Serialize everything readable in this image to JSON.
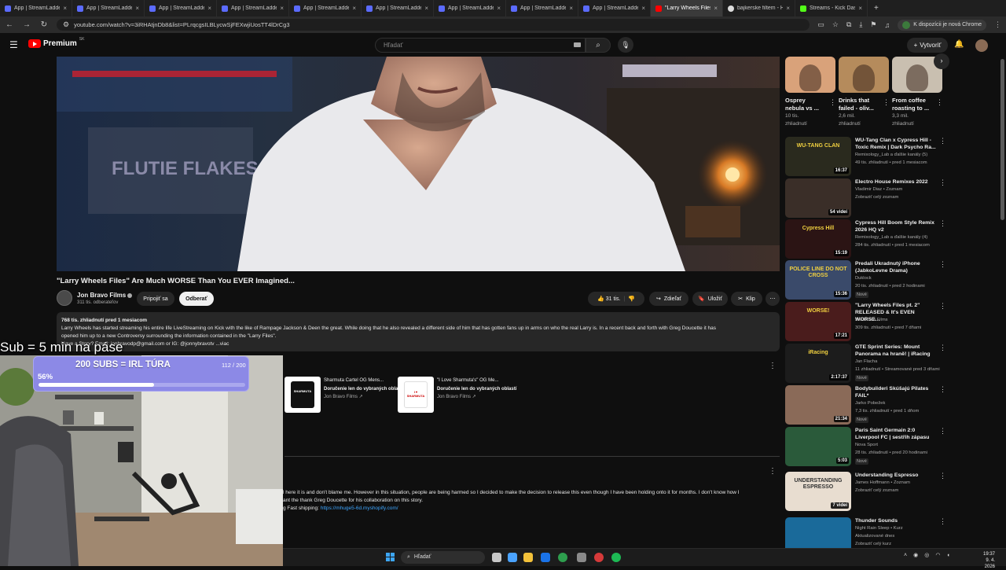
{
  "tabs": [
    {
      "title": "App | StreamLadder",
      "icon": "streamladder-icon",
      "active": false
    },
    {
      "title": "App | StreamLadder",
      "icon": "streamladder-icon",
      "active": false
    },
    {
      "title": "App | StreamLadder",
      "icon": "streamladder-icon",
      "active": false
    },
    {
      "title": "App | StreamLadder",
      "icon": "streamladder-icon",
      "active": false
    },
    {
      "title": "App | StreamLadder",
      "icon": "streamladder-icon",
      "active": false
    },
    {
      "title": "App | StreamLadder",
      "icon": "streamladder-icon",
      "active": false
    },
    {
      "title": "App | StreamLadder",
      "icon": "streamladder-icon",
      "active": false
    },
    {
      "title": "App | StreamLadder",
      "icon": "streamladder-icon",
      "active": false
    },
    {
      "title": "App | StreamLadder",
      "icon": "streamladder-icon",
      "active": false
    },
    {
      "title": "\"Larry Wheels Files\" Ar",
      "icon": "youtube-icon",
      "active": true
    },
    {
      "title": "bajkerske filtem - Hľad",
      "icon": "google-icon",
      "active": false
    },
    {
      "title": "Streams - Kick Dashbo",
      "icon": "kick-icon",
      "active": false
    }
  ],
  "browser": {
    "url": "youtube.com/watch?v=3iRHAtjnDb8&list=PLrqcgsILBLycwSjFEXwjiUosTT4lDrCg3",
    "profile_label": "K dispozícii je nová Chrome",
    "new_tab": "+"
  },
  "youtube": {
    "logo_text": "Premium",
    "logo_country": "SK",
    "search_placeholder": "Hľadať",
    "create_label": "Vytvoriť"
  },
  "video": {
    "title": "\"Larry Wheels Files\" Are Much WORSE Than You EVER Imagined...",
    "channel": "Jon Bravo Films",
    "subscribers": "311 tis. odberateľov",
    "join_label": "Pripojiť sa",
    "subscribe_label": "Odberať",
    "likes": "31 tis.",
    "share_label": "Zdieľať",
    "save_label": "Uložiť",
    "clip_label": "Klip",
    "description": {
      "stats": "768 tis. zhliadnutí  pred 1 mesiacom",
      "line1": "Larry Wheels has started streaming his entire life LiveStreaming on Kick with the like of Rampage Jackson & Deen the great. While doing that he also revealed a different side of him that has gotten fans up in arms on who the real Larry is. In a recent back and forth with Greg Doucette it has",
      "line2": "opened him up to a new Controversy surrounding the information contained in the \"Larry Files\".",
      "line3": "Have a Story? Email: jonbravodp@gmail.com or IG: @jonnybravotv",
      "more": "...viac"
    },
    "banner_wall": "FLUTIE FLAKES"
  },
  "merch": [
    {
      "title": "Sharmuta Cartel OG Mens...",
      "shipping": "Doručenie len do vybraných oblastí",
      "channel": "Jon Bravo Films",
      "shirt_color": "#111111"
    },
    {
      "title": "\"I Love Sharmuta's\" OG Me...",
      "shipping": "Doručenie len do vybraných oblastí",
      "channel": "Jon Bravo Films",
      "shirt_color": "#ffffff"
    }
  ],
  "merch_shirt_texts": [
    "SHARMUTA",
    "I ♥ SHARMUTA"
  ],
  "pinned_comment": {
    "line1": "l here it is and don't blame me. However in this situation, people are being harmed so I decided to make the decision to release this even though I have been holding onto it for months. I don't know how I",
    "line2": "ant the thank Greg Doucette for his collaboration on this story.",
    "line3_prefix": "g Fast shipping: ",
    "link": "https://mhuge5-6d.myshopify.com/"
  },
  "shorts": [
    {
      "title_l1": "Osprey",
      "title_l2": "nebula vs ...",
      "views_l1": "10 tis.",
      "views_l2": "zhliadnutí",
      "color": "#d9a27a"
    },
    {
      "title_l1": "Drinks that",
      "title_l2": "failed - oliv...",
      "views_l1": "2,6 mil.",
      "views_l2": "zhliadnutí",
      "color": "#b58b5c"
    },
    {
      "title_l1": "From coffee",
      "title_l2": "roasting to ...",
      "views_l1": "3,3 mil.",
      "views_l2": "zhliadnutí",
      "color": "#c9bfb0"
    }
  ],
  "recommendations": [
    {
      "title_l1": "WU-Tang Clan x Cypress Hill -",
      "title_l2": "Toxic Remix | Dark Psycho Ra...",
      "channel": "Remixology_Lab a ďalšie kanály (5)",
      "meta": "49 tis. zhliadnutí • pred 1 mesiacom",
      "badge": "16:37",
      "new": "",
      "thumb": "#2a2a1e",
      "thumb_text": "WU-TANG CLAN"
    },
    {
      "title_l1": "Electro House Remixes 2022",
      "title_l2": "",
      "channel": "Vladimir Diaz • Zoznam",
      "meta": "Zobraziť celý zoznam",
      "badge": "54 videí",
      "new": "",
      "thumb": "#3a2e28",
      "thumb_text": ""
    },
    {
      "title_l1": "Cypress Hill Boom Style Remix",
      "title_l2": "2026 HQ v2",
      "channel": "Remixology_Lab a ďalšie kanály (4)",
      "meta": "284 tis. zhliadnutí • pred 1 mesiacom",
      "badge": "15:19",
      "new": "",
      "thumb": "#2b1414",
      "thumb_text": "Cypress Hill"
    },
    {
      "title_l1": "Predali Ukradnutý iPhone",
      "title_l2": "(JabkoLevne Drama)",
      "channel": "Duklock",
      "meta": "20 tis. zhliadnutí • pred 2 hodinami",
      "badge": "15:36",
      "new": "Nové",
      "thumb": "#3a4a6a",
      "thumb_text": "POLICE LINE DO NOT CROSS"
    },
    {
      "title_l1": "\"Larry Wheels Files pt. 2\"",
      "title_l2": "RELEASED & It's EVEN WORSE...",
      "channel": "Jon Bravo Films",
      "meta": "309 tis. zhliadnutí • pred 7 dňami",
      "badge": "17:21",
      "new": "",
      "thumb": "#4a1c1c",
      "thumb_text": "WORSE!"
    },
    {
      "title_l1": "GTE Sprint Series: Mount",
      "title_l2": "Panorama na hraně! | iRacing",
      "channel": "Jan Flacha",
      "meta": "11 zhliadnutí • Streamované pred 3 dňami",
      "badge": "2:17:37",
      "new": "Nové",
      "thumb": "#1c1c1c",
      "thumb_text": "iRacing"
    },
    {
      "title_l1": "Bodybuilderi Skúšajú Pilates",
      "title_l2": "FAIL*",
      "channel": "Jarko Pobežek",
      "meta": "7,3 tis. zhliadnutí • pred 1 dňom",
      "badge": "21:34",
      "new": "Nové",
      "thumb": "#8a6a58",
      "thumb_text": ""
    },
    {
      "title_l1": "Paris Saint Germain 2:0",
      "title_l2": "Liverpool FC | sestřih zápasu",
      "channel": "Nova Sport",
      "meta": "28 tis. zhliadnutí • pred 20 hodinami",
      "badge": "5:03",
      "new": "Nové",
      "thumb": "#2a5a3a",
      "thumb_text": ""
    },
    {
      "title_l1": "Understanding Espresso",
      "title_l2": "",
      "channel": "James Hoffmann • Zoznam",
      "meta": "Zobraziť celý zoznam",
      "badge": "7 videí",
      "new": "",
      "thumb": "#e8ddd0",
      "thumb_text": "UNDERSTANDING ESPRESSO"
    },
    {
      "title_l1": "Thunder Sounds",
      "title_l2": "",
      "channel": "Night Rain Sleep • Kurz",
      "meta": "Aktualizované dnes",
      "badge": "",
      "new": "",
      "thumb": "#1a6a9a",
      "thumb_text": ""
    }
  ],
  "recommendations_extra_line": "Zobraziť celý kurz",
  "overlay": {
    "label": "Sub = 5 min na páse",
    "goal_title": "200 SUBS = IRL TÚRA",
    "goal_count": "112 / 200",
    "goal_percent": "56%",
    "goal_progress": 0.56
  },
  "taskbar": {
    "search_placeholder": "Hľadať",
    "time": "19:37",
    "date": "9. 4. 2026"
  },
  "colors": {
    "accent": "#ff0000",
    "link": "#3ea6ff",
    "goal": "#8c89e6"
  }
}
